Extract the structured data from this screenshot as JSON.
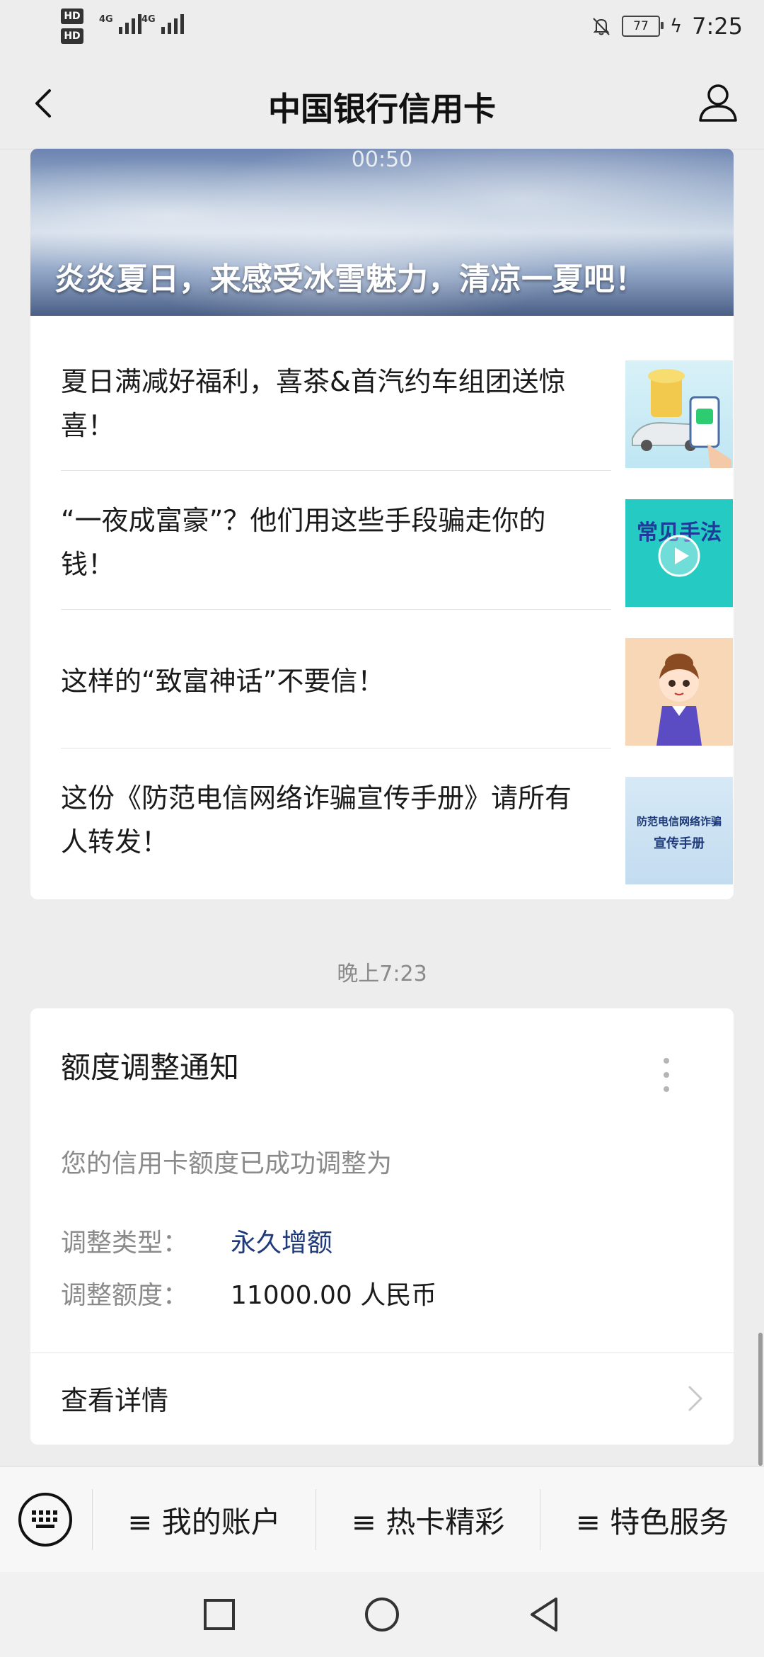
{
  "status_bar": {
    "hd_labels": [
      "HD",
      "HD"
    ],
    "network_labels": [
      "4G",
      "4G"
    ],
    "battery_level": "77",
    "time": "7:25"
  },
  "header": {
    "title": "中国银行信用卡",
    "back_icon": "chevron-left-icon",
    "profile_icon": "person-icon"
  },
  "news": {
    "banner_time": "00:50",
    "banner_caption": "炎炎夏日，来感受冰雪魅力，清凉一夏吧！",
    "items": [
      {
        "title": "夏日满减好福利，喜茶&首汽约车组团送惊喜！"
      },
      {
        "title": "“一夜成富豪”？他们用这些手段骗走你的钱！",
        "thumb_text": "常见手法"
      },
      {
        "title": "这样的“致富神话”不要信！"
      },
      {
        "title": "这份《防范电信网络诈骗宣传手册》请所有人转发！",
        "thumb_text_line1": "防范电信网络诈骗",
        "thumb_text_line2": "宣传手册"
      }
    ]
  },
  "timestamp": "晚上7:23",
  "notice": {
    "title": "额度调整通知",
    "description": "您的信用卡额度已成功调整为",
    "type_label": "调整类型：",
    "type_value": "永久增额",
    "amount_label": "调整额度：",
    "amount_value": "11000.00 人民币",
    "detail_link": "查看详情"
  },
  "bottom_menu": {
    "items": [
      "≡ 我的账户",
      "≡ 热卡精彩",
      "≡ 特色服务"
    ]
  },
  "colors": {
    "accent_blue": "#1f3a7a",
    "teal_thumb": "#25cbc3"
  }
}
